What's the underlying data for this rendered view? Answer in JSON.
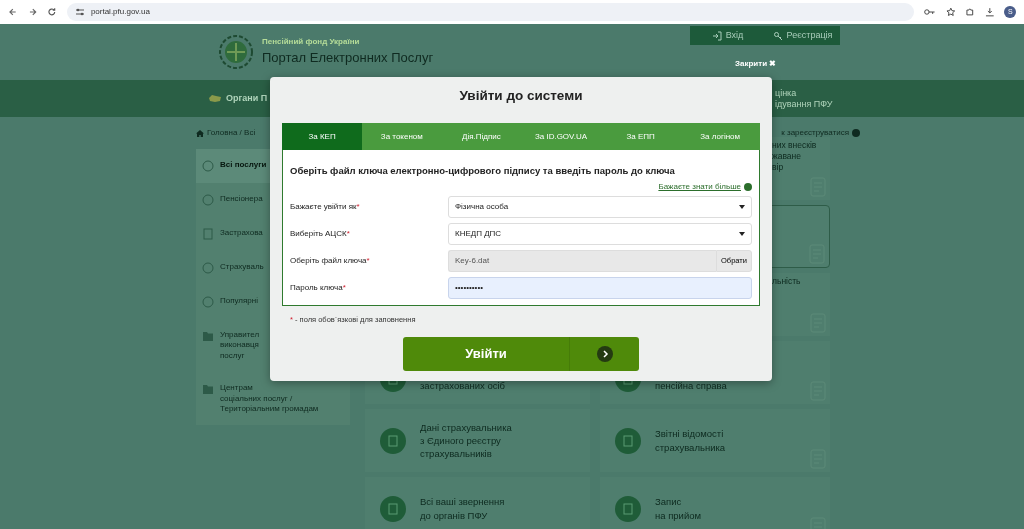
{
  "browser": {
    "url": "portal.pfu.gov.ua",
    "profile_initial": "S"
  },
  "header": {
    "org_name": "Пенсійний фонд України",
    "portal_title": "Портал Електронних Послуг",
    "buttons": [
      {
        "label": "Вхід",
        "kind": "login"
      },
      {
        "label": "Реєстрація",
        "kind": "register"
      }
    ]
  },
  "nav": {
    "left_label": "Органи П",
    "right_lines": [
      "цінка",
      "ідування ПФУ"
    ]
  },
  "breadcrumb": {
    "trail": "Головна / Всі",
    "register_hint": "к зареєструватися"
  },
  "sidebar": {
    "items": [
      {
        "lines": [
          "Всі послуги"
        ],
        "selected": true,
        "kind": "circle"
      },
      {
        "lines": [
          "Пенсіонера"
        ],
        "selected": false,
        "kind": "circle"
      },
      {
        "lines": [
          "Застрахова"
        ],
        "selected": false,
        "kind": "doc"
      },
      {
        "lines": [
          "Страхуваль"
        ],
        "selected": false,
        "kind": "circle"
      },
      {
        "lines": [
          "Популярні"
        ],
        "selected": false,
        "kind": "circle"
      },
      {
        "lines": [
          "Управител",
          "виконавця",
          "послуг"
        ],
        "selected": false,
        "kind": "folder"
      },
      {
        "lines": [
          "Центрам",
          "соціальних послуг /",
          "Територіальним громадам"
        ],
        "selected": false,
        "kind": "folder"
      }
    ]
  },
  "card_rows": [
    {
      "right": {
        "lines": [
          "них внесків",
          "жаване",
          "вір"
        ],
        "highlighted": false
      }
    },
    {
      "right": {
        "highlighted": true
      }
    },
    {
      "right": {
        "lines": [
          "льність"
        ],
        "highlighted": false
      }
    },
    {
      "center": {
        "lines": [
          "застрахованих осіб"
        ],
        "highlighted": false
      },
      "right": {
        "lines": [
          "пенсійна справа"
        ],
        "highlighted": false
      }
    },
    {
      "center": {
        "lines": [
          "Дані страхувальника",
          "з Єдиного реєстру",
          "страхувальників"
        ],
        "highlighted": false
      },
      "right": {
        "lines": [
          "Звітні відомості",
          "страхувальника"
        ],
        "highlighted": false
      }
    },
    {
      "center": {
        "lines": [
          "Всі ваші звернення",
          "до органів ПФУ"
        ],
        "highlighted": false
      },
      "right": {
        "lines": [
          "Запис",
          "на прийом"
        ],
        "highlighted": false
      }
    }
  ],
  "modal": {
    "close_label": "Закрити ✖",
    "title": "Увійти до системи",
    "tabs": [
      {
        "label": "За КЕП",
        "selected": true
      },
      {
        "label": "За токеном",
        "selected": false
      },
      {
        "label": "Дія.Підпис",
        "selected": false
      },
      {
        "label": "За ID.GOV.UA",
        "selected": false
      },
      {
        "label": "За ЕПП",
        "selected": false
      },
      {
        "label": "За логіном",
        "selected": false
      }
    ],
    "heading": "Оберіть файл ключа електронно-цифрового підпису та введіть пароль до ключа",
    "more_link": "Бажаєте знати більше",
    "fields": [
      {
        "label": "Бажаєте увійти як",
        "mark": "*",
        "kind": "select",
        "value": "Фізична особа",
        "focused": false
      },
      {
        "label": "Виберіть АЦСК",
        "mark": "*",
        "kind": "select",
        "value": "КНЕДП ДПС",
        "focused": false
      },
      {
        "label": "Оберіть файл ключа",
        "mark": "*",
        "kind": "file",
        "value": "Key-6.dat",
        "button": "Обрати",
        "focused": false
      },
      {
        "label": "Пароль ключа",
        "mark": "*",
        "kind": "password",
        "value": "••••••••••",
        "focused": true
      }
    ],
    "required_note": {
      "mark": "*",
      "text": "- поля обов`язкові для заповнення"
    },
    "submit": "Увійти"
  }
}
